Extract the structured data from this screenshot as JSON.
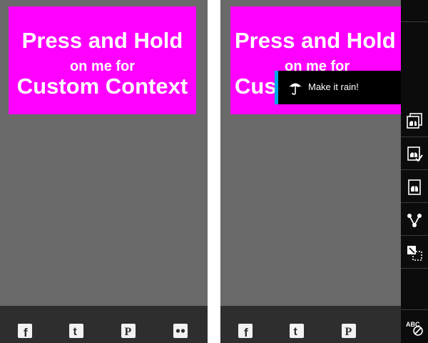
{
  "hold_box": {
    "line1": "Press and Hold",
    "line2": "on me for",
    "line3": "Custom Context"
  },
  "hold_box_right": {
    "line1": "Press and Hold",
    "line2": "on me for",
    "line3": "Cus"
  },
  "context_menu": {
    "item_label": "Make it rain!",
    "item_icon": "umbrella-icon"
  },
  "share_bar": {
    "icons": [
      "facebook-icon",
      "tumblr-icon",
      "pinterest-icon",
      "flickr-icon"
    ],
    "letters": {
      "tumblr": "t",
      "pinterest": "P",
      "facebook": "f"
    }
  },
  "action_bar": {
    "items": [
      "copy-image-icon",
      "save-image-icon",
      "set-as-icon",
      "share-icon",
      "select-more-icon",
      "spell-check-off-icon"
    ],
    "spell_check_label": "ABC"
  },
  "colors": {
    "canvas": "#696969",
    "bottom_bar": "#2e2e2e",
    "hold_box": "#ff00ff",
    "popup_bg": "#000000",
    "popup_accent": "#00a8e8",
    "action_bar": "#0c0c0c"
  }
}
